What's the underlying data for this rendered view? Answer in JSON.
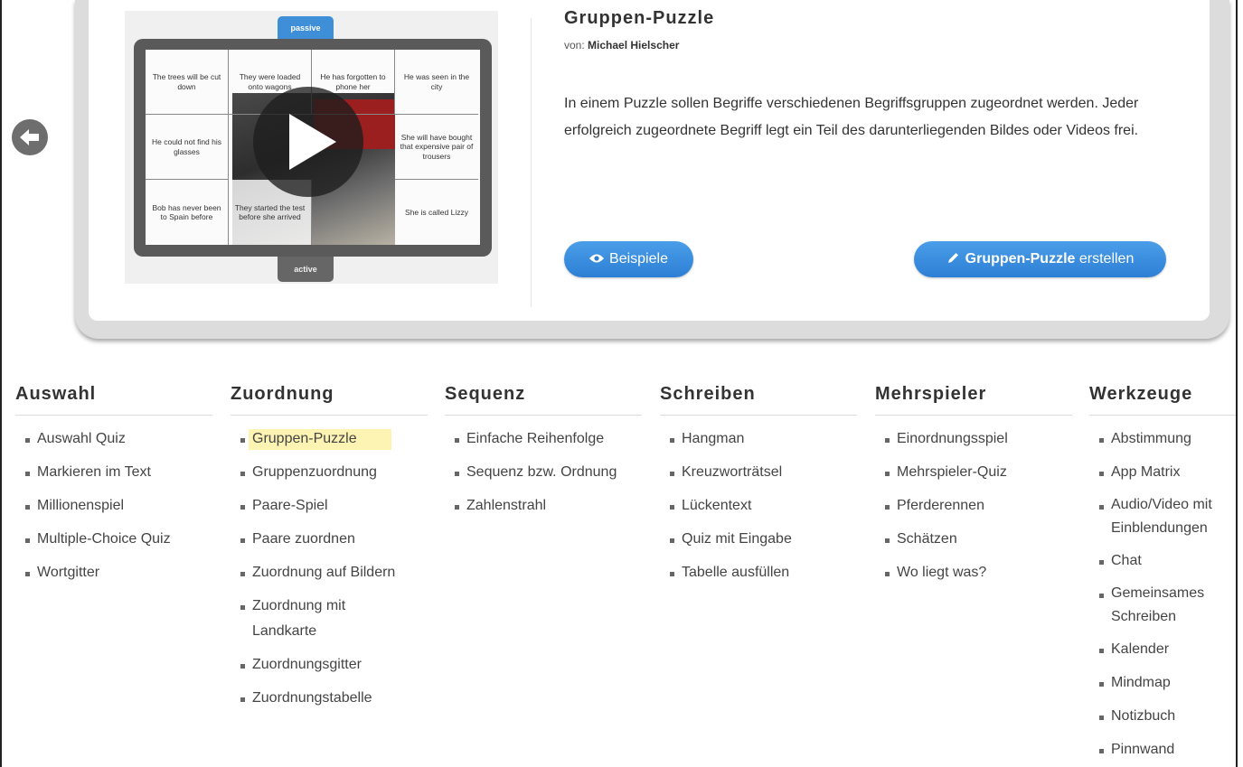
{
  "preview": {
    "tab_passive": "passive",
    "tab_active": "active",
    "pieces": [
      "The trees will be cut down",
      "They were loaded onto wagons",
      "He has forgotten to phone her",
      "He was seen in the city",
      "He could not find his glasses",
      "She will have bought that expensive pair of trousers",
      "Bob has never been to Spain before",
      "They started the test before she arrived",
      "She is called Lizzy"
    ]
  },
  "info": {
    "title": "Gruppen-Puzzle",
    "author_prefix": "von:",
    "author_name": "Michael Hielscher",
    "description": "In einem Puzzle sollen Begriffe verschiedenen Begriffsgruppen zugeordnet werden. Jeder erfolgreich zugeordnete Begriff legt ein Teil des darunterliegenden Bildes oder Videos frei.",
    "btn_examples": "Beispiele",
    "btn_create_bold": "Gruppen-Puzzle",
    "btn_create_rest": "erstellen"
  },
  "categories": [
    {
      "title": "Auswahl",
      "items": [
        "Auswahl Quiz",
        "Markieren im Text",
        "Millionenspiel",
        "Multiple-Choice Quiz",
        "Wortgitter"
      ]
    },
    {
      "title": "Zuordnung",
      "items": [
        "Gruppen-Puzzle",
        "Gruppenzuordnung",
        "Paare-Spiel",
        "Paare zuordnen",
        "Zuordnung auf Bildern",
        "Zuordnung mit Landkarte",
        "Zuordnungsgitter",
        "Zuordnungstabelle"
      ]
    },
    {
      "title": "Sequenz",
      "items": [
        "Einfache Reihenfolge",
        "Sequenz bzw. Ordnung",
        "Zahlenstrahl"
      ]
    },
    {
      "title": "Schreiben",
      "items": [
        "Hangman",
        "Kreuzworträtsel",
        "Lückentext",
        "Quiz mit Eingabe",
        "Tabelle ausfüllen"
      ]
    },
    {
      "title": "Mehrspieler",
      "items": [
        "Einordnungsspiel",
        "Mehrspieler-Quiz",
        "Pferderennen",
        "Schätzen",
        "Wo liegt was?"
      ]
    },
    {
      "title": "Werkzeuge",
      "items": [
        "Abstimmung",
        "App Matrix",
        "Audio/Video mit Einblendungen",
        "Chat",
        "Gemeinsames Schreiben",
        "Kalender",
        "Mindmap",
        "Notizbuch",
        "Pinnwand"
      ]
    }
  ],
  "highlighted_item": "Gruppen-Puzzle",
  "colors": {
    "accent": "#2d7fd5",
    "highlight": "#fdf3b2"
  }
}
